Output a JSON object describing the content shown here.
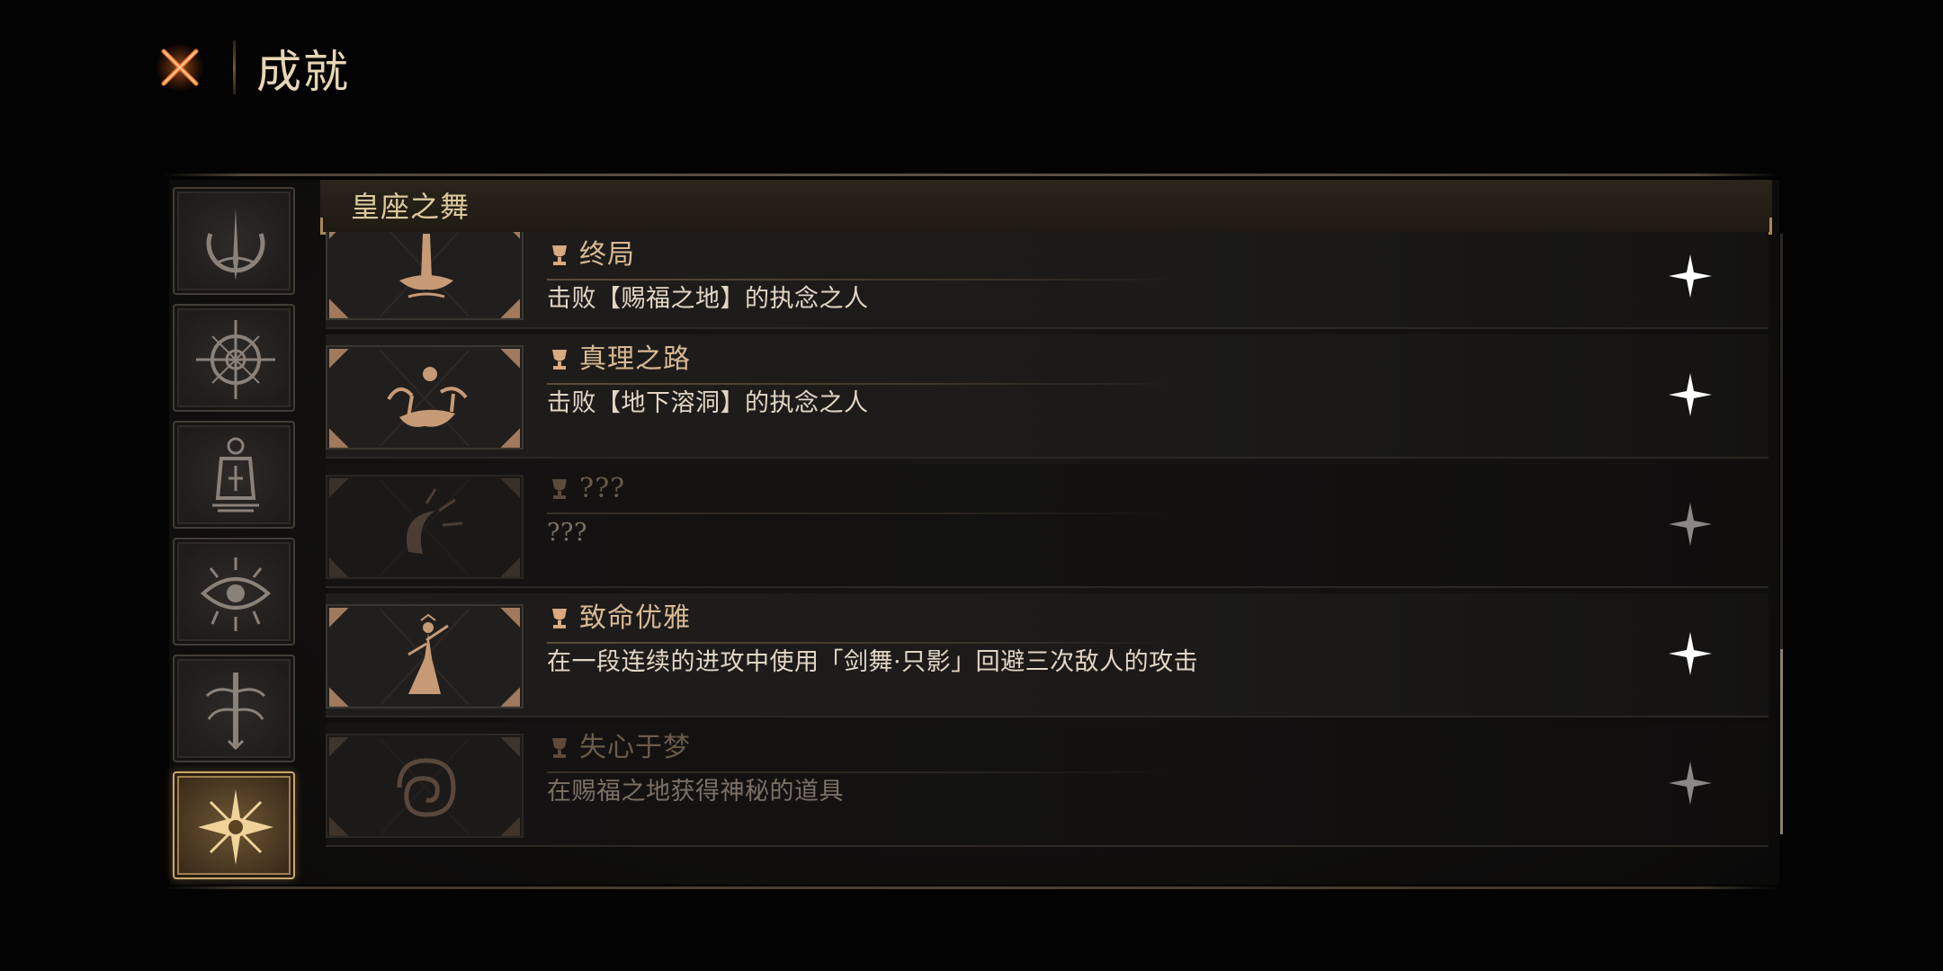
{
  "header": {
    "title": "成就",
    "close_icon": "close-x-icon",
    "accent": "#e0672a"
  },
  "categories": [
    {
      "icon": "crescent-spire-icon",
      "active": false
    },
    {
      "icon": "compass-rose-icon",
      "active": false
    },
    {
      "icon": "lantern-icon",
      "active": false
    },
    {
      "icon": "thorned-eye-icon",
      "active": false
    },
    {
      "icon": "root-tree-icon",
      "active": false
    },
    {
      "icon": "radiant-sigil-icon",
      "active": true
    }
  ],
  "list": {
    "title": "皇座之舞",
    "items": [
      {
        "title": "终局",
        "desc": "击败【赐福之地】的执念之人",
        "unlocked": true,
        "art": "tower-on-island"
      },
      {
        "title": "真理之路",
        "desc": "击败【地下溶洞】的执念之人",
        "unlocked": true,
        "art": "trees-and-sun"
      },
      {
        "title": "???",
        "desc": "???",
        "unlocked": false,
        "art": "eclipse-crescent"
      },
      {
        "title": "致命优雅",
        "desc": "在一段连续的进攻中使用「剑舞·只影」回避三次敌人的攻击",
        "unlocked": true,
        "art": "dancing-figure"
      },
      {
        "title": "失心于梦",
        "desc": "在赐福之地获得神秘的道具",
        "unlocked": false,
        "art": "spiral-cloud"
      }
    ]
  },
  "colors": {
    "gold": "#d9b994",
    "active_border": "#c9a66b",
    "star": "#ffffff"
  }
}
